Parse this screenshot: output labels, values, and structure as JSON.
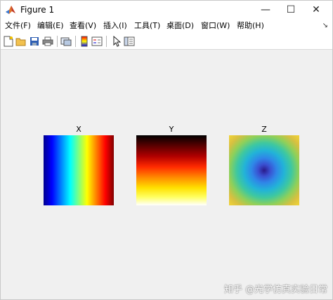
{
  "window": {
    "title": "Figure 1",
    "minimize_glyph": "—",
    "maximize_glyph": "☐",
    "close_glyph": "✕"
  },
  "menu": {
    "items": [
      "文件(F)",
      "编辑(E)",
      "查看(V)",
      "插入(I)",
      "工具(T)",
      "桌面(D)",
      "窗口(W)",
      "帮助(H)"
    ],
    "dock_glyph": "↘"
  },
  "toolbar": {
    "icons": [
      "new-figure-icon",
      "open-file-icon",
      "save-icon",
      "print-icon",
      "link-plot-icon",
      "colorbar-icon",
      "legend-icon",
      "pointer-icon",
      "property-inspector-icon"
    ]
  },
  "figure": {
    "axes": [
      {
        "title": "X",
        "colormap": "jet",
        "direction": "horizontal"
      },
      {
        "title": "Y",
        "colormap": "hot",
        "direction": "vertical"
      },
      {
        "title": "Z",
        "colormap": "parula",
        "direction": "radial"
      }
    ]
  },
  "watermark": "知乎 @光学仿真实验日常",
  "colors": {
    "window_bg": "#f0f0f0",
    "titlebar_bg": "#ffffff"
  }
}
